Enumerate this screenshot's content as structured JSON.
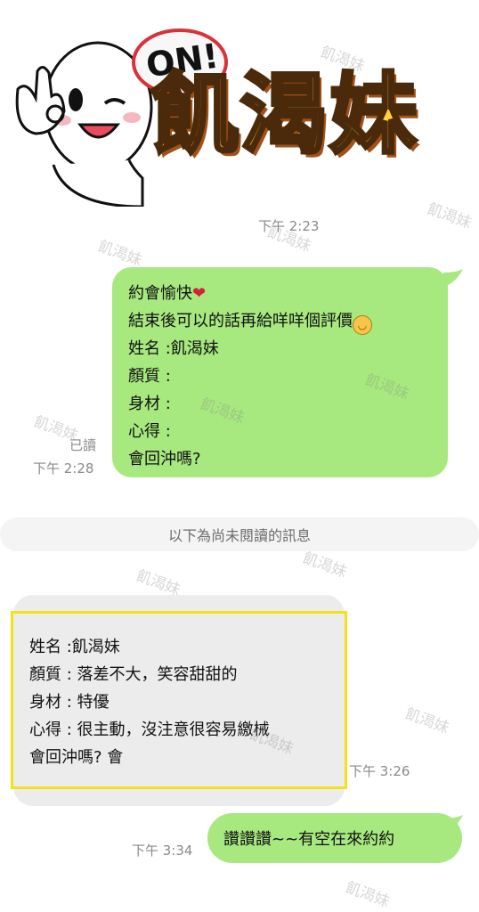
{
  "sticker": {
    "title": "飢渴妹",
    "badge": "ON!"
  },
  "messages": {
    "sticker_time": "下午 2:23",
    "outgoing1": {
      "lines": [
        "約會愉快",
        "結束後可以的話再給咩咩個評價",
        "姓名 :飢渴妹",
        "顏質 :",
        "身材 :",
        "心得 :",
        "會回沖嗎?"
      ],
      "read_label": "已讀",
      "time": "下午 2:28"
    },
    "unread_divider": "以下為尚未閱讀的訊息",
    "incoming1": {
      "lines": [
        "姓名 :飢渴妹",
        "顏質 : 落差不大，笑容甜甜的",
        "身材 : 特優",
        "心得 : 很主動，沒注意很容易繳械",
        "會回沖嗎? 會"
      ],
      "time": "下午 3:26"
    },
    "outgoing2": {
      "text": "讚讚讚~~有空在來約約",
      "time": "下午 3:34"
    }
  },
  "watermark": "飢渴妹",
  "colors": {
    "outgoing_bubble": "#a7e87f",
    "incoming_bubble": "#ececec",
    "highlight_border": "#f2e21a"
  },
  "icons": [
    "ok-hand-character-sticker",
    "heart-emoji",
    "smile-emoji"
  ]
}
